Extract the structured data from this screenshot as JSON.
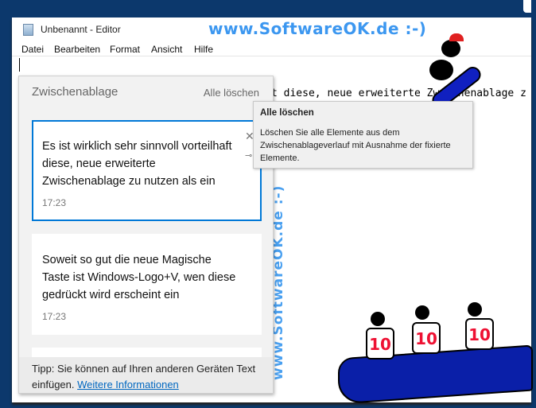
{
  "window": {
    "title": "Unbenannt - Editor"
  },
  "menu": [
    "Datei",
    "Bearbeiten",
    "Format",
    "Ansicht",
    "Hilfe"
  ],
  "editor": {
    "text": "t diese, neue erweiterte Zwischenablage z"
  },
  "watermark": {
    "top": "www.SoftwareOK.de :-)",
    "vertical": "www.SoftwareOK.de :-)"
  },
  "clipboard": {
    "title": "Zwischenablage",
    "clear_all": "Alle löschen",
    "items": [
      {
        "text": "Es ist wirklich sehr sinnvoll vorteilhaft diese, neue erweiterte Zwischenablage zu nutzen als ein",
        "time": "17:23",
        "selected": true
      },
      {
        "text": "Soweit so gut die neue Magische Taste ist Windows-Logo+V, wen diese gedrückt wird erscheint ein",
        "time": "17:23",
        "selected": false
      }
    ],
    "footer_text": "Tipp: Sie können auf Ihren anderen Geräten Text einfügen.",
    "footer_link": "Weitere Informationen"
  },
  "tooltip": {
    "title": "Alle löschen",
    "body": "Löschen Sie alle Elemente aus dem Zwischenablageverlauf mit Ausnahme der fixierte Elemente."
  },
  "judges": [
    "10",
    "10",
    "10"
  ],
  "colors": {
    "desktop": "#0c386c",
    "accent": "#0078d7",
    "watermark": "#3c97f0",
    "sofa": "#0a1fa8",
    "score": "#ee1133"
  }
}
